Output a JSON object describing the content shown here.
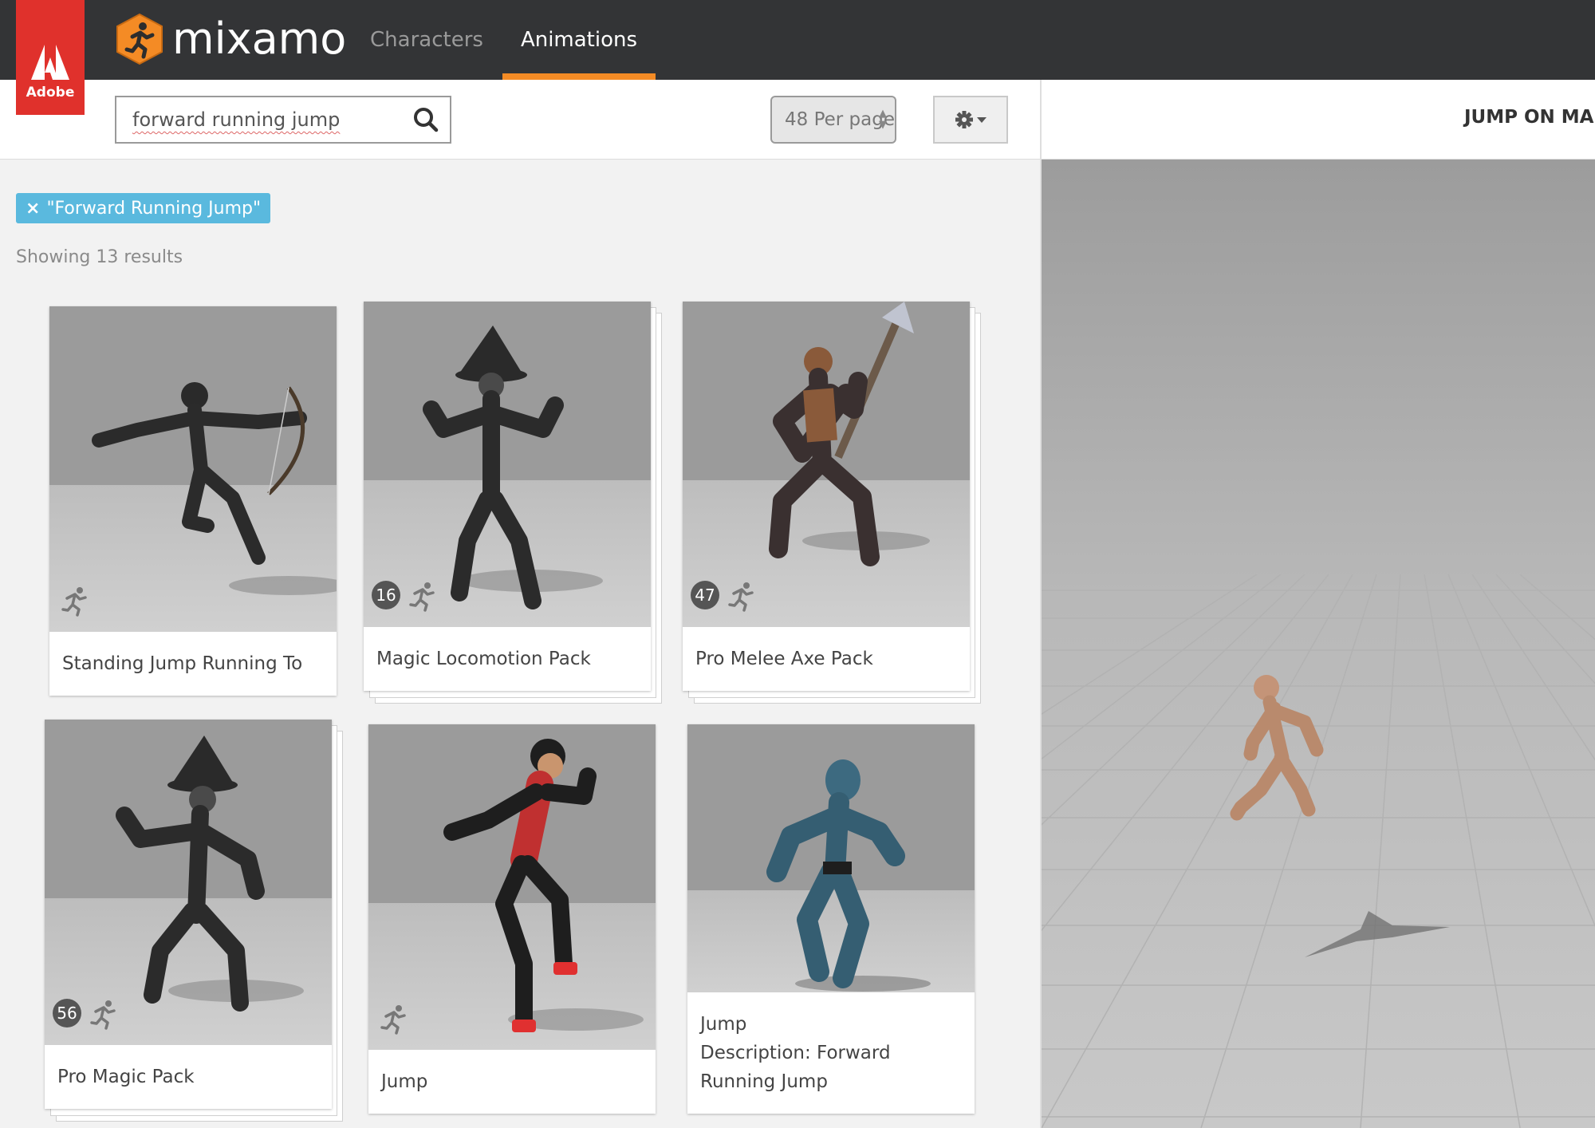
{
  "brand": {
    "adobe_label": "Adobe",
    "app_name": "mixamo"
  },
  "nav": {
    "tabs": [
      {
        "label": "Characters"
      },
      {
        "label": "Animations",
        "active": true
      }
    ]
  },
  "search": {
    "value": "forward running jump",
    "per_page": "48 Per page"
  },
  "filter": {
    "chip_label": "\"Forward Running Jump\"",
    "remove": "×"
  },
  "results": {
    "count_text": "Showing 13 results"
  },
  "cards": [
    {
      "title": "Standing Jump Running To",
      "count": null
    },
    {
      "title": "Magic Locomotion Pack",
      "count": "16"
    },
    {
      "title": "Pro Melee Axe Pack",
      "count": "47"
    },
    {
      "title": "Pro Magic Pack",
      "count": "56"
    },
    {
      "title": "Jump",
      "count": null
    },
    {
      "title_line1": "Jump",
      "title_line2": "Description: Forward Running Jump",
      "count": null
    }
  ],
  "preview": {
    "title": "JUMP ON MAN"
  },
  "colors": {
    "accent": "#f48b25",
    "adobe_red": "#e0312c",
    "chip": "#5ab9de",
    "topbar": "#333436"
  }
}
